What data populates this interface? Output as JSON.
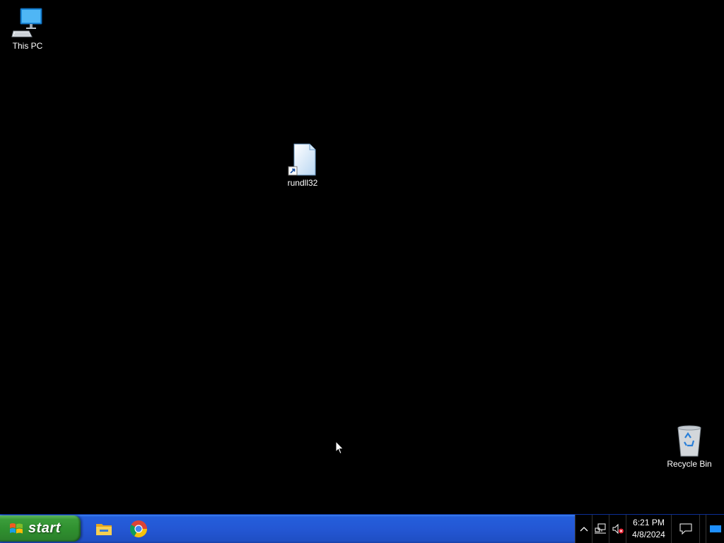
{
  "desktop": {
    "icons": [
      {
        "label": "This PC",
        "icon": "this-pc-icon"
      },
      {
        "label": "rundll32",
        "icon": "file-shortcut-icon"
      },
      {
        "label": "Recycle Bin",
        "icon": "recycle-bin-icon"
      }
    ]
  },
  "taskbar": {
    "start_label": "start",
    "pinned": [
      {
        "name": "File Explorer",
        "icon": "folder-icon"
      },
      {
        "name": "Google Chrome",
        "icon": "chrome-icon"
      }
    ],
    "tray": {
      "show_hidden_icon": "chevron-up-icon",
      "network_icon": "network-icon",
      "volume_icon": "volume-muted-icon",
      "time": "6:21 PM",
      "date": "4/8/2024",
      "notifications_icon": "action-center-icon",
      "show_desktop_icon": "show-desktop-icon"
    }
  },
  "colors": {
    "taskbar_blue": "#245edb",
    "start_green": "#3a9d3a",
    "desktop_bg": "#000000"
  }
}
